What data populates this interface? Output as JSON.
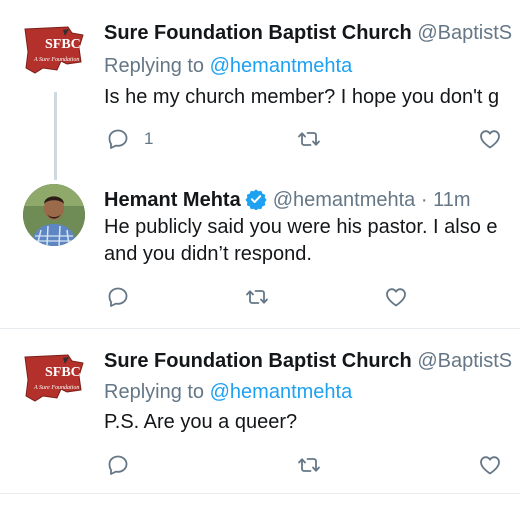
{
  "tweets": [
    {
      "name": "Sure Foundation Baptist Church",
      "handle": "@BaptistS",
      "replying_prefix": "Replying to",
      "replying_to": "@hemantmehta",
      "text": "Is he my church member? I hope you don't g",
      "reply_count": "1",
      "avatar": {
        "kind": "church-logo",
        "logo_text": "SFBC",
        "logo_subtext": "A Sure Foundation"
      }
    },
    {
      "name": "Hemant Mehta",
      "handle": "@hemantmehta",
      "time_sep": " · ",
      "time": "11m",
      "text_line1": "He publicly said you were his pastor. I also e",
      "text_line2": "and you didn’t respond.",
      "verified": true,
      "avatar": {
        "kind": "profile-photo"
      }
    },
    {
      "name": "Sure Foundation Baptist Church",
      "handle": "@BaptistS",
      "replying_prefix": "Replying to",
      "replying_to": "@hemantmehta",
      "text": "P.S. Are you a queer?",
      "avatar": {
        "kind": "church-logo",
        "logo_text": "SFBC",
        "logo_subtext": "A Sure Foundation"
      }
    }
  ],
  "icons": [
    "reply-icon",
    "retweet-icon",
    "like-icon",
    "verified-badge-icon"
  ],
  "colors": {
    "link": "#1da1f2",
    "muted": "#657786",
    "text": "#14171a",
    "divider": "#e6ecf0",
    "thread_line": "#cfd9de",
    "logo_red": "#b3312a"
  }
}
